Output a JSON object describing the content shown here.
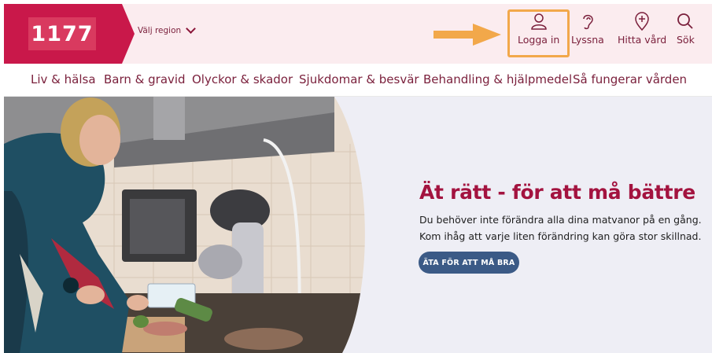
{
  "header": {
    "logo_text": "1177",
    "region_label": "Välj region",
    "utilities": [
      {
        "label": "Logga in",
        "icon": "user-icon"
      },
      {
        "label": "Lyssna",
        "icon": "ear-icon"
      },
      {
        "label": "Hitta vård",
        "icon": "location-plus-icon"
      },
      {
        "label": "Sök",
        "icon": "search-icon"
      }
    ]
  },
  "nav": {
    "items": [
      "Liv & hälsa",
      "Barn & gravid",
      "Olyckor & skador",
      "Sjukdomar & besvär",
      "Behandling & hjälpmedel",
      "Så fungerar vården"
    ]
  },
  "hero": {
    "title": "Ät rätt - för att må bättre",
    "lines": [
      "Du behöver inte förändra alla dina matvanor på en gång.",
      "Kom ihåg att varje liten förändring kan göra stor skillnad."
    ],
    "button_label": "ÄTA FÖR ATT MÅ BRA"
  },
  "colors": {
    "brand": "#c9184a",
    "header_bg": "#fbecef",
    "text_dark_red": "#7a1f3b",
    "title": "#a3133f",
    "button": "#3b5a86",
    "highlight": "#f2a84a"
  }
}
